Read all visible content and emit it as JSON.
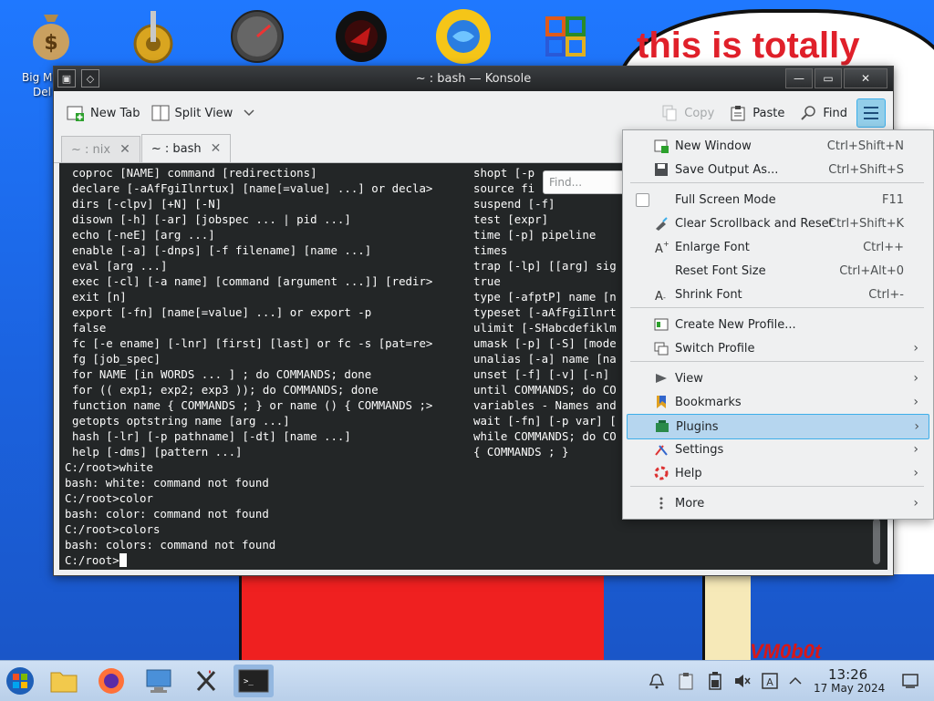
{
  "desktop": {
    "cloud_text": "this is totally",
    "signature": "VM0b0t",
    "icon_labels": [
      "Big M",
      "Del"
    ]
  },
  "window": {
    "title": "~ : bash — Konsole"
  },
  "toolbar": {
    "new_tab": "New Tab",
    "split_view": "Split View",
    "copy": "Copy",
    "paste": "Paste",
    "find": "Find"
  },
  "tabs": [
    {
      "label": "~ : nix",
      "active": false
    },
    {
      "label": "~ : bash",
      "active": true
    }
  ],
  "terminal": {
    "left_column": [
      "coproc [NAME] command [redirections]",
      "declare [-aAfFgiIlnrtux] [name[=value] ...] or decla>",
      "dirs [-clpv] [+N] [-N]",
      "disown [-h] [-ar] [jobspec ... | pid ...]",
      "echo [-neE] [arg ...]",
      "enable [-a] [-dnps] [-f filename] [name ...]",
      "eval [arg ...]",
      "exec [-cl] [-a name] [command [argument ...]] [redir>",
      "exit [n]",
      "export [-fn] [name[=value] ...] or export -p",
      "false",
      "fc [-e ename] [-lnr] [first] [last] or fc -s [pat=re>",
      "fg [job_spec]",
      "for NAME [in WORDS ... ] ; do COMMANDS; done",
      "for (( exp1; exp2; exp3 )); do COMMANDS; done",
      "function name { COMMANDS ; } or name () { COMMANDS ;>",
      "getopts optstring name [arg ...]",
      "hash [-lr] [-p pathname] [-dt] [name ...]",
      "help [-dms] [pattern ...]"
    ],
    "right_column": [
      "shopt [-p",
      "source fi",
      "suspend [-f]",
      "test [expr]",
      "time [-p] pipeline",
      "times",
      "trap [-lp] [[arg] sig",
      "true",
      "type [-afptP] name [n",
      "typeset [-aAfFgiIlnrt",
      "ulimit [-SHabcdefiklm",
      "umask [-p] [-S] [mode",
      "unalias [-a] name [na",
      "unset [-f] [-v] [-n]",
      "until COMMANDS; do CO",
      "variables - Names and",
      "wait [-fn] [-p var] [",
      "while COMMANDS; do CO",
      "{ COMMANDS ; }"
    ],
    "output": [
      "C:/root>white",
      "bash: white: command not found",
      "C:/root>color",
      "bash: color: command not found",
      "C:/root>colors",
      "bash: colors: command not found"
    ],
    "prompt": "C:/root>",
    "find_placeholder": "Find..."
  },
  "menu": {
    "items": [
      {
        "label": "New Window",
        "shortcut": "Ctrl+Shift+N",
        "icon": "new-window-icon"
      },
      {
        "label": "Save Output As...",
        "shortcut": "Ctrl+Shift+S",
        "icon": "save-icon"
      },
      {
        "label": "Full Screen Mode",
        "shortcut": "F11",
        "icon": "checkbox"
      },
      {
        "label": "Clear Scrollback and Reset",
        "shortcut": "Ctrl+Shift+K",
        "icon": "clear-icon"
      },
      {
        "label": "Enlarge Font",
        "shortcut": "Ctrl++",
        "icon": "font-enlarge-icon"
      },
      {
        "label": "Reset Font Size",
        "shortcut": "Ctrl+Alt+0",
        "icon": ""
      },
      {
        "label": "Shrink Font",
        "shortcut": "Ctrl+-",
        "icon": "font-shrink-icon"
      },
      {
        "label": "Create New Profile...",
        "shortcut": "",
        "icon": "profile-new-icon"
      },
      {
        "label": "Switch Profile",
        "shortcut": "",
        "icon": "switch-profile-icon",
        "submenu": true
      },
      {
        "label": "View",
        "shortcut": "",
        "icon": "view-icon",
        "submenu": true
      },
      {
        "label": "Bookmarks",
        "shortcut": "",
        "icon": "bookmarks-icon",
        "submenu": true
      },
      {
        "label": "Plugins",
        "shortcut": "",
        "icon": "plugins-icon",
        "submenu": true,
        "highlighted": true
      },
      {
        "label": "Settings",
        "shortcut": "",
        "icon": "settings-icon",
        "submenu": true
      },
      {
        "label": "Help",
        "shortcut": "",
        "icon": "help-icon",
        "submenu": true
      },
      {
        "label": "More",
        "shortcut": "",
        "icon": "more-icon",
        "submenu": true
      }
    ]
  },
  "taskbar": {
    "time": "13:26",
    "date": "17 May 2024"
  },
  "colors": {
    "accent": "#3daee9",
    "terminal_bg": "#232627",
    "highlight": "#b6d6ef"
  }
}
